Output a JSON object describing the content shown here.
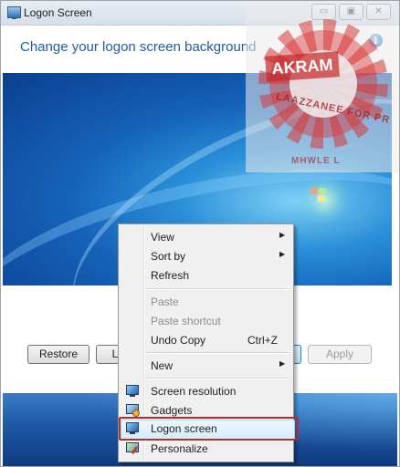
{
  "window": {
    "title": "Logon Screen",
    "caption_buttons": {
      "minimize": "▭",
      "maximize": "▣",
      "close": "✕"
    }
  },
  "main": {
    "heading": "Change your logon screen background",
    "info_glyph": "i"
  },
  "buttons": {
    "restore": "Restore",
    "second": "L",
    "apply": "Apply"
  },
  "watermark": {
    "banner": "AKRAM",
    "line1": "LAAZZANEE FOR PR",
    "line2": "MHWLE L"
  },
  "context_menu": {
    "items": [
      {
        "label": "View",
        "submenu": true
      },
      {
        "label": "Sort by",
        "submenu": true
      },
      {
        "label": "Refresh"
      },
      {
        "label": "Paste",
        "disabled": true
      },
      {
        "label": "Paste shortcut",
        "disabled": true
      },
      {
        "label": "Undo Copy",
        "shortcut": "Ctrl+Z"
      },
      {
        "label": "New",
        "submenu": true
      },
      {
        "label": "Screen resolution",
        "icon": "monitor-icon"
      },
      {
        "label": "Gadgets",
        "icon": "gadgets-icon"
      },
      {
        "label": "Logon screen",
        "icon": "monitor-icon",
        "highlighted": true
      },
      {
        "label": "Personalize",
        "icon": "personalize-icon"
      }
    ],
    "arrow": "▶"
  },
  "colors": {
    "heading": "#1e5ca8",
    "highlight_border": "#b03030",
    "menu_bg": "#f0f0f0"
  }
}
